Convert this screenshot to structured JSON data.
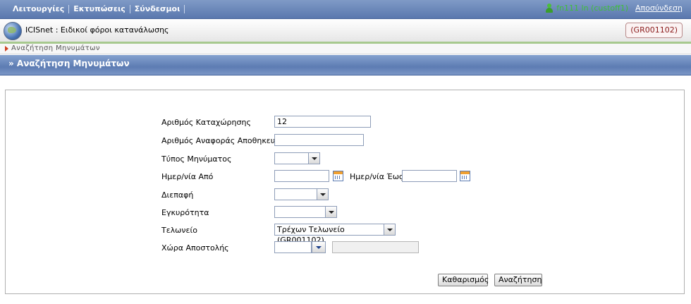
{
  "topbar": {
    "menu": [
      "Λειτουργίες",
      "Εκτυπώσεις",
      "Σύνδεσμοι"
    ],
    "user": "fn111 ln (custoff1)",
    "logout": "Αποσύνδεση"
  },
  "app": {
    "title": "ICISnet : Ειδικοί φόροι κατανάλωσης",
    "office_badge": "(GR001102)"
  },
  "breadcrumb": "Αναζήτηση Μηνυμάτων",
  "section_title": "» Αναζήτηση Μηνυμάτων",
  "form": {
    "registration_number": {
      "label": "Αριθμός Καταχώρησης",
      "value": "12"
    },
    "consignor_reference": {
      "label": "Αριθμός Αναφοράς Αποθηκευτή",
      "value": ""
    },
    "message_type": {
      "label": "Τύπος Μηνύματος",
      "value": ""
    },
    "date_from": {
      "label": "Ημερ/νία Από",
      "value": ""
    },
    "date_to": {
      "label": "Ημερ/νία Έως",
      "value": ""
    },
    "interface": {
      "label": "Διεπαφή",
      "value": ""
    },
    "validity": {
      "label": "Εγκυρότητα",
      "value": ""
    },
    "customs_office": {
      "label": "Τελωνείο",
      "value": "Τρέχων Τελωνείο (GR001102)"
    },
    "dispatch_country": {
      "label": "Χώρα Αποστολής",
      "code": "",
      "name": ""
    }
  },
  "buttons": {
    "clear": "Καθαρισμός",
    "search": "Αναζήτηση"
  },
  "colors": {
    "topbar": "#5a78ae",
    "section": "#5d7cb3",
    "accent_green": "#3fbf3a",
    "badge_text": "#8b1a1a"
  }
}
